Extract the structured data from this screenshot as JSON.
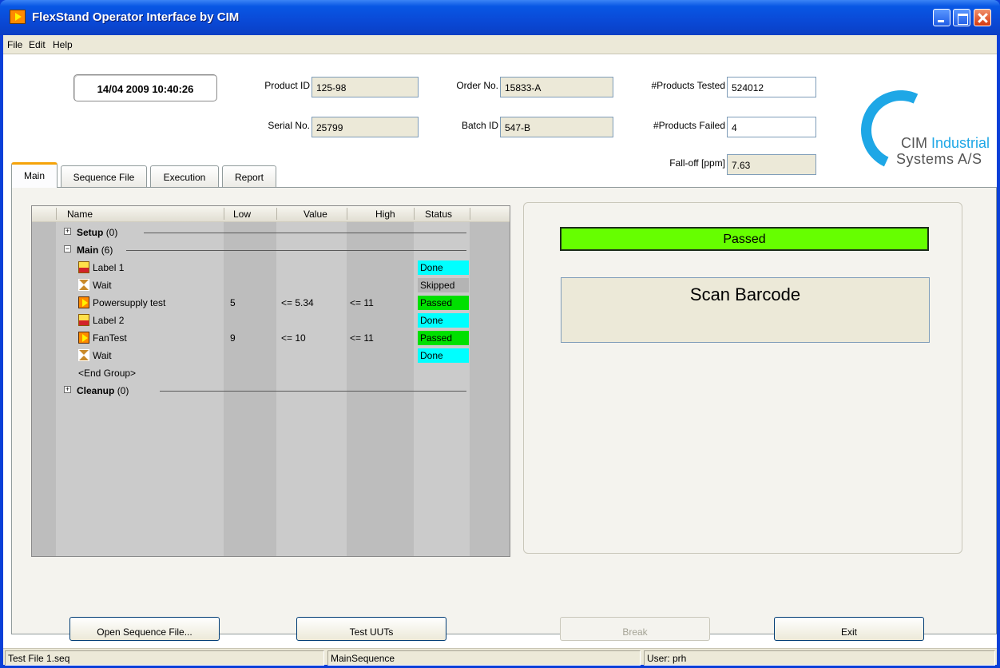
{
  "window": {
    "title": "FlexStand Operator Interface by CIM"
  },
  "menu": {
    "items": [
      "File",
      "Edit",
      "Help"
    ]
  },
  "header": {
    "datetime": "14/04 2009  10:40:26",
    "product_id": {
      "label": "Product ID",
      "value": "125-98"
    },
    "serial_no": {
      "label": "Serial No.",
      "value": "25799"
    },
    "order_no": {
      "label": "Order No.",
      "value": "15833-A"
    },
    "batch_id": {
      "label": "Batch ID",
      "value": "547-B"
    },
    "products_tested": {
      "label": "#Products Tested",
      "value": "524012"
    },
    "products_failed": {
      "label": "#Products Failed",
      "value": "4"
    },
    "fall_off": {
      "label": "Fall-off [ppm]",
      "value": "7.63"
    }
  },
  "logo": {
    "line1_a": "CIM",
    "line1_b": " Industrial",
    "line2": "Systems A/S",
    "color": "#1ea7e6"
  },
  "tabs": [
    "Main",
    "Sequence File",
    "Execution",
    "Report"
  ],
  "tree": {
    "columns": [
      "Name",
      "Low",
      "Value",
      "High",
      "Status"
    ],
    "groups": [
      {
        "expander": "+",
        "name": "Setup",
        "count": "(0)"
      },
      {
        "expander": "−",
        "name": "Main",
        "count": "(6)"
      },
      {
        "expander": "+",
        "name": "Cleanup",
        "count": "(0)"
      }
    ],
    "steps": [
      {
        "icon": "label-icon",
        "name": "Label 1",
        "low": "",
        "value": "",
        "high": "",
        "status": "Done",
        "status_color": "#00ffff"
      },
      {
        "icon": "hourglass-icon",
        "name": "Wait",
        "low": "",
        "value": "",
        "high": "",
        "status": "Skipped",
        "status_color": "#b4b4b4"
      },
      {
        "icon": "action-icon",
        "name": "Powersupply test",
        "low": "5",
        "value": "<= 5.34",
        "high": "<= 11",
        "status": "Passed",
        "status_color": "#00e000"
      },
      {
        "icon": "label-icon",
        "name": "Label 2",
        "low": "",
        "value": "",
        "high": "",
        "status": "Done",
        "status_color": "#00ffff"
      },
      {
        "icon": "action-icon",
        "name": "FanTest",
        "low": "9",
        "value": "<= 10",
        "high": "<= 11",
        "status": "Passed",
        "status_color": "#00e000"
      },
      {
        "icon": "hourglass-icon",
        "name": "Wait",
        "low": "",
        "value": "",
        "high": "",
        "status": "Done",
        "status_color": "#00ffff"
      }
    ],
    "end_group": "<End Group>"
  },
  "result": {
    "text": "Passed",
    "color": "#66ff00"
  },
  "prompt": {
    "text": "Scan Barcode"
  },
  "buttons": {
    "open_sequence": "Open Sequence File...",
    "test_uuts": "Test UUTs",
    "break": "Break",
    "exit": "Exit"
  },
  "statusbar": {
    "file": "Test File 1.seq",
    "sequence": "MainSequence",
    "user": "User: prh"
  }
}
